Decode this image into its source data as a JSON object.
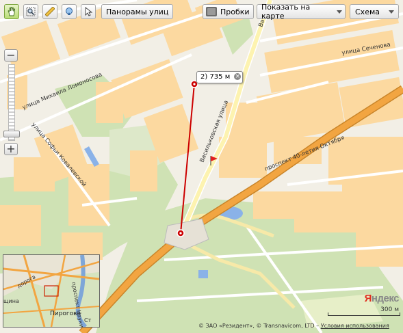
{
  "toolbar": {
    "panoramas_label": "Панорамы улиц",
    "traffic_label": "Пробки",
    "show_on_map_label": "Показать на карте",
    "map_type_label": "Схема"
  },
  "ruler": {
    "label": "2)  735 м",
    "close_glyph": "×"
  },
  "zoom": {
    "minus": "−",
    "plus": "+",
    "level_fraction": 0.93
  },
  "streets": {
    "lomonosova": "улица Михаила Ломоносова",
    "kovalevskoy": "улица Софьи Ковалевской",
    "vasilkovskaya": "Васильковская улица",
    "sechenova": "улица Сеченова",
    "prospekt_40": "проспект 40-летия Октября",
    "vasilkovskaya_top": "Ва"
  },
  "minimap": {
    "pirogovo": "Пирогово",
    "dorog": "дорога",
    "shchina": "щина",
    "prospekt_nauki": "проспект Науки",
    "st": "Ст"
  },
  "footer": {
    "copyright_text": "© ЗАО «Резидент», © Transnavicom, LTD –",
    "terms_link": "Условия использования",
    "logo_y": "Я",
    "logo_rest": "ндекс",
    "scale_label": "300 м"
  },
  "colors": {
    "block": "#fcd9a0",
    "park": "#cfe2b4",
    "road_main": "#f2a541",
    "water": "#8ab2e8",
    "measure_line": "#cc0000"
  },
  "icons": {
    "hand": "hand-icon",
    "magnifier": "magnifier-icon",
    "ruler": "ruler-icon",
    "routes": "route-icon",
    "cursor": "cursor-icon",
    "traffic": "traffic-icon"
  }
}
